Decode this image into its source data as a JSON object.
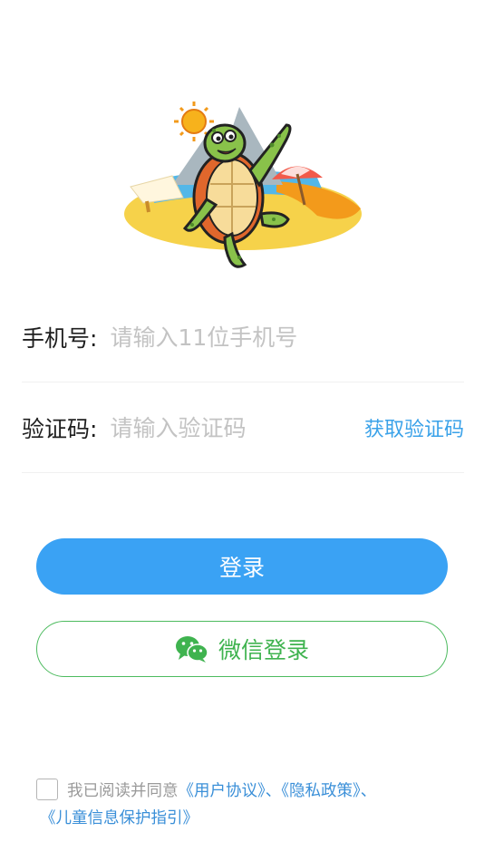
{
  "form": {
    "phone_label": "手机号:",
    "phone_placeholder": "请输入11位手机号",
    "code_label": "验证码:",
    "code_placeholder": "请输入验证码",
    "get_code_label": "获取验证码"
  },
  "buttons": {
    "login_label": "登录",
    "wechat_label": "微信登录"
  },
  "agreement": {
    "prefix": "我已阅读并同意",
    "user_agreement": "《用户协议》",
    "separator1": "、",
    "privacy_policy": "《隐私政策》",
    "separator2": "、",
    "children_guide": "《儿童信息保护指引》"
  },
  "colors": {
    "primary": "#3aa2f4",
    "wechat_green": "#3fb34f",
    "link": "#3a8fd8",
    "placeholder": "#c3c3c3"
  },
  "icons": {
    "hero": "turtle-beach-illustration",
    "wechat": "wechat-icon",
    "checkbox": "checkbox-unchecked"
  }
}
